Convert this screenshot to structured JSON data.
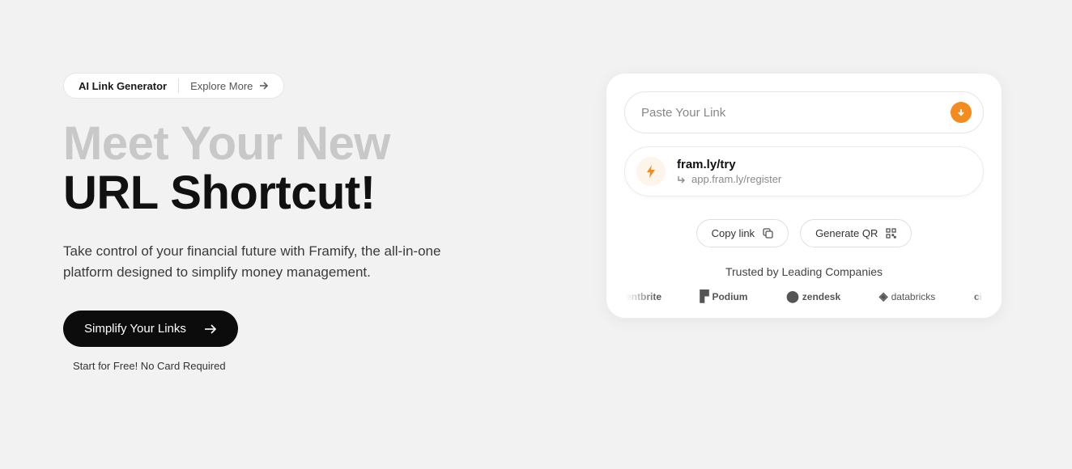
{
  "pill": {
    "label": "AI Link Generator",
    "explore": "Explore More"
  },
  "hero": {
    "title_line1": "Meet Your New",
    "title_line2": "URL Shortcut!",
    "subtitle": "Take control of your financial future with Framify, the all-in-one platform designed to simplify money management.",
    "cta": "Simplify Your Links",
    "cta_note": "Start for Free! No Card Required"
  },
  "card": {
    "input_placeholder": "Paste Your Link",
    "result_short": "fram.ly/try",
    "result_long": "app.fram.ly/register",
    "copy_label": "Copy link",
    "qr_label": "Generate QR",
    "trusted_title": "Trusted by Leading Companies",
    "logos": {
      "l1": "entbrite",
      "l2": "Podium",
      "l3": "zendesk",
      "l4": "databricks",
      "l5": "ci"
    }
  }
}
